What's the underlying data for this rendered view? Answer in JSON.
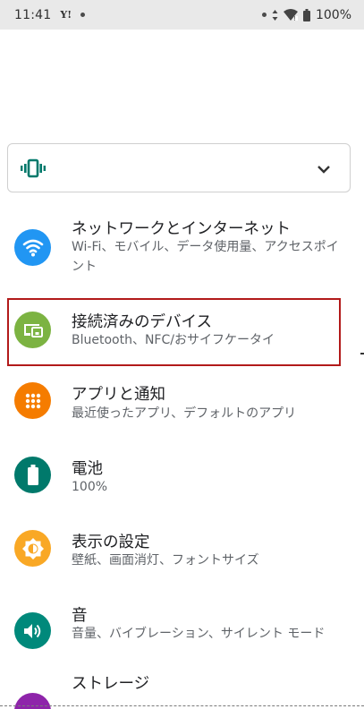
{
  "status_bar": {
    "time": "11:41",
    "carrier": "Y!",
    "battery_percent": "100%"
  },
  "volume_panel": {
    "mode_icon": "vibrate-icon",
    "expand_icon": "chevron-down-icon"
  },
  "settings": [
    {
      "title": "ネットワークとインターネット",
      "subtitle": "Wi-Fi、モバイル、データ使用量、アクセスポイント",
      "icon": "wifi-icon",
      "color": "#2196f3"
    },
    {
      "title": "接続済みのデバイス",
      "subtitle": "Bluetooth、NFC/おサイフケータイ",
      "icon": "devices-icon",
      "color": "#7cb342"
    },
    {
      "title": "アプリと通知",
      "subtitle": "最近使ったアプリ、デフォルトのアプリ",
      "icon": "apps-grid-icon",
      "color": "#f57c00"
    },
    {
      "title": "電池",
      "subtitle": "100%",
      "icon": "battery-icon",
      "color": "#00796b"
    },
    {
      "title": "表示の設定",
      "subtitle": "壁紙、画面消灯、フォントサイズ",
      "icon": "brightness-icon",
      "color": "#f9a825"
    },
    {
      "title": "音",
      "subtitle": "音量、バイブレーション、サイレント モード",
      "icon": "volume-icon",
      "color": "#00897b"
    },
    {
      "title": "ストレージ",
      "subtitle": "",
      "icon": "storage-icon",
      "color": "#8e24aa"
    }
  ],
  "colors": {
    "highlight": "#b21a1a",
    "accent_teal": "#00796b"
  }
}
